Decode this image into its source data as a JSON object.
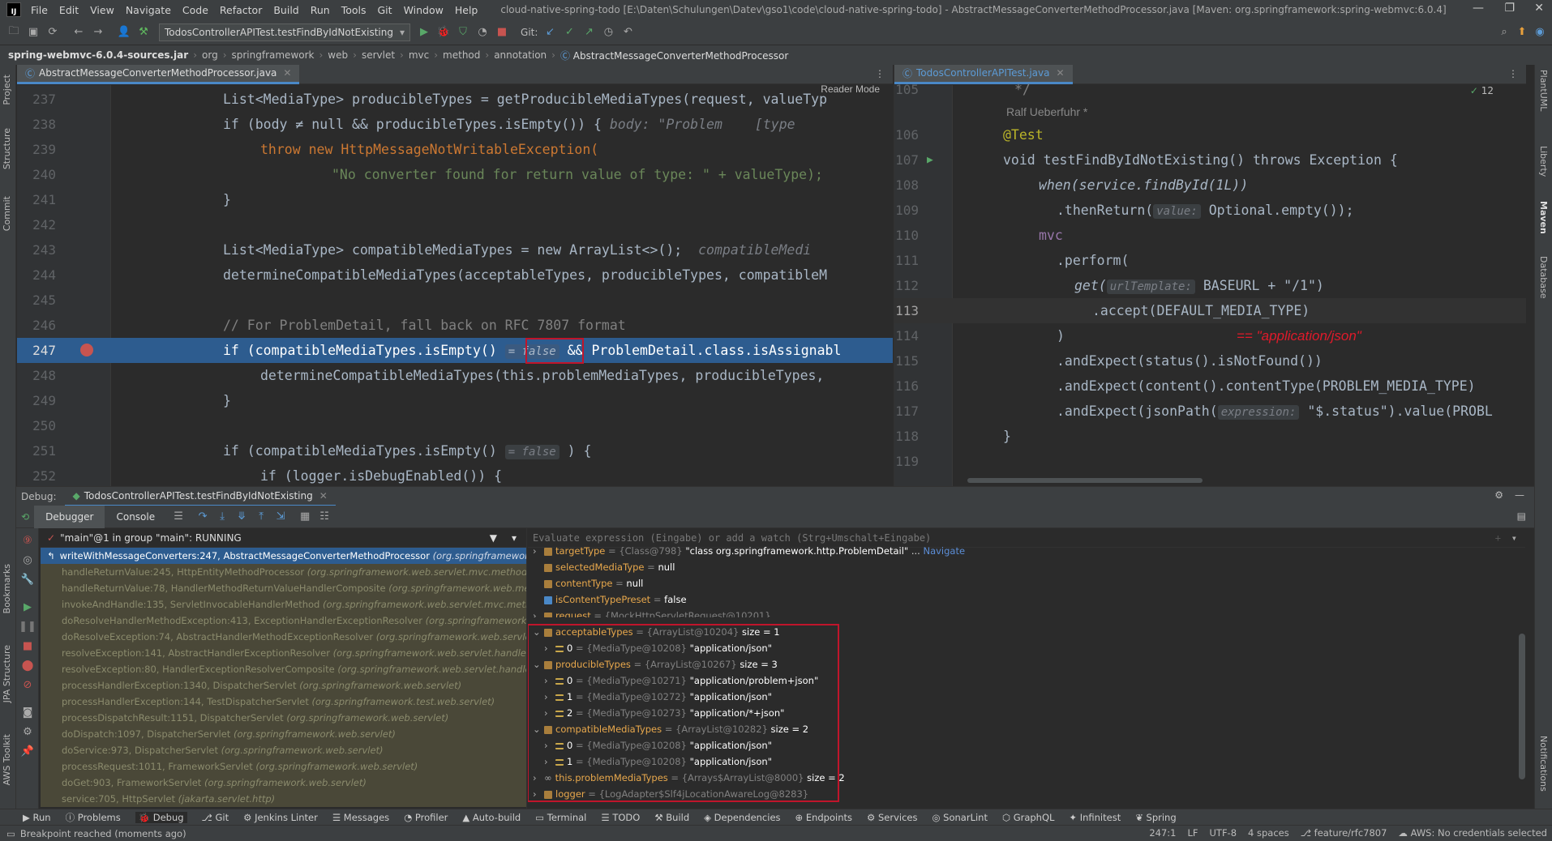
{
  "app": {
    "logo": "IJ",
    "window_title": "cloud-native-spring-todo [E:\\Daten\\Schulungen\\Datev\\gso1\\code\\cloud-native-spring-todo] - AbstractMessageConverterMethodProcessor.java [Maven: org.springframework:spring-webmvc:6.0.4]"
  },
  "menu": [
    "File",
    "Edit",
    "View",
    "Navigate",
    "Code",
    "Refactor",
    "Build",
    "Run",
    "Tools",
    "Git",
    "Window",
    "Help"
  ],
  "toolbar": {
    "run_config": "TodosControllerAPITest.testFindByIdNotExisting",
    "git_label": "Git:"
  },
  "breadcrumb": [
    "spring-webmvc-6.0.4-sources.jar",
    "org",
    "springframework",
    "web",
    "servlet",
    "mvc",
    "method",
    "annotation",
    "AbstractMessageConverterMethodProcessor"
  ],
  "left_strip": [
    "Project",
    "Structure",
    "Commit",
    "Bookmarks",
    "JPA Structure",
    "AWS Toolkit"
  ],
  "right_strip": [
    "PlantUML",
    "Liberty",
    "Maven",
    "Database",
    "Notifications"
  ],
  "editor_left": {
    "tab": "AbstractMessageConverterMethodProcessor.java",
    "reader_mode": "Reader Mode",
    "lines": [
      {
        "n": "237",
        "text": "List<MediaType> producibleTypes = getProducibleMediaTypes(request, valueTyp"
      },
      {
        "n": "238",
        "pre": "if (body ≠ null && producibleTypes.isEmpty()) {",
        "hint": "body: \"Problem",
        "hint2": "[type"
      },
      {
        "n": "239",
        "text": "throw new HttpMessageNotWritableException("
      },
      {
        "n": "240",
        "text": "\"No converter found for return value of type: \" + valueType);"
      },
      {
        "n": "241",
        "text": "}"
      },
      {
        "n": "242",
        "text": ""
      },
      {
        "n": "243",
        "pre": "List<MediaType> compatibleMediaTypes = new ArrayList<>();",
        "hint": "compatibleMedi"
      },
      {
        "n": "244",
        "text": "determineCompatibleMediaTypes(acceptableTypes, producibleTypes, compatibleM"
      },
      {
        "n": "245",
        "text": ""
      },
      {
        "n": "246",
        "text": "// For ProblemDetail, fall back on RFC 7807 format"
      },
      {
        "n": "247",
        "pre": "if (compatibleMediaTypes.isEmpty()",
        "hint": "= false",
        "post": "&& ProblemDetail.class.isAssignabl"
      },
      {
        "n": "248",
        "text": "determineCompatibleMediaTypes(this.problemMediaTypes, producibleTypes,"
      },
      {
        "n": "249",
        "text": "}"
      },
      {
        "n": "250",
        "text": ""
      },
      {
        "n": "251",
        "pre": "if (compatibleMediaTypes.isEmpty()",
        "hint": "= false",
        "post": ") {"
      },
      {
        "n": "252",
        "text": "if (logger.isDebugEnabled()) {"
      }
    ]
  },
  "editor_right": {
    "tab": "TodosControllerAPITest.java",
    "problems_count": "12",
    "author": "Ralf Ueberfuhr *",
    "lines": [
      {
        "n": "105",
        "text": "*/"
      },
      {
        "n": "106",
        "text": "@Test"
      },
      {
        "n": "107",
        "text": "void testFindByIdNotExisting() throws Exception {"
      },
      {
        "n": "108",
        "text": "when(service.findById(1L))"
      },
      {
        "n": "109",
        "pre": ".thenReturn(",
        "hint": "value:",
        "post": "Optional.empty());"
      },
      {
        "n": "110",
        "text": "mvc"
      },
      {
        "n": "111",
        "text": ".perform("
      },
      {
        "n": "112",
        "pre": "get(",
        "hint": "urlTemplate:",
        "post": "BASEURL + \"/1\")"
      },
      {
        "n": "113",
        "text": ".accept(DEFAULT_MEDIA_TYPE)"
      },
      {
        "n": "114",
        "text": ")",
        "annotation": "== \"application/json\""
      },
      {
        "n": "115",
        "text": ".andExpect(status().isNotFound())"
      },
      {
        "n": "116",
        "text": ".andExpect(content().contentType(PROBLEM_MEDIA_TYPE)"
      },
      {
        "n": "117",
        "pre": ".andExpect(jsonPath(",
        "hint": "expression:",
        "post": "\"$.status\").value(PROBL"
      },
      {
        "n": "118",
        "text": "}"
      },
      {
        "n": "119",
        "text": ""
      }
    ]
  },
  "debug": {
    "label": "Debug:",
    "session_tab": "TodosControllerAPITest.testFindByIdNotExisting",
    "tabs": [
      "Debugger",
      "Console"
    ],
    "thread": "\"main\"@1 in group \"main\": RUNNING",
    "eval_placeholder": "Evaluate expression (Eingabe) or add a watch (Strg+Umschalt+Eingabe)",
    "frames": [
      {
        "m": "writeWithMessageConverters:247, AbstractMessageConverterMethodProcessor",
        "p": "(org.springframework.web.ser"
      },
      {
        "m": "handleReturnValue:245, HttpEntityMethodProcessor",
        "p": "(org.springframework.web.servlet.mvc.method.annota"
      },
      {
        "m": "handleReturnValue:78, HandlerMethodReturnValueHandlerComposite",
        "p": "(org.springframework.web.method.sup"
      },
      {
        "m": "invokeAndHandle:135, ServletInvocableHandlerMethod",
        "p": "(org.springframework.web.servlet.mvc.method.annot"
      },
      {
        "m": "doResolveHandlerMethodException:413, ExceptionHandlerExceptionResolver",
        "p": "(org.springframework.web.serv"
      },
      {
        "m": "doResolveException:74, AbstractHandlerMethodExceptionResolver",
        "p": "(org.springframework.web.servlet.handle"
      },
      {
        "m": "resolveException:141, AbstractHandlerExceptionResolver",
        "p": "(org.springframework.web.servlet.handler)"
      },
      {
        "m": "resolveException:80, HandlerExceptionResolverComposite",
        "p": "(org.springframework.web.servlet.handler)"
      },
      {
        "m": "processHandlerException:1340, DispatcherServlet",
        "p": "(org.springframework.web.servlet)"
      },
      {
        "m": "processHandlerException:144, TestDispatcherServlet",
        "p": "(org.springframework.test.web.servlet)"
      },
      {
        "m": "processDispatchResult:1151, DispatcherServlet",
        "p": "(org.springframework.web.servlet)"
      },
      {
        "m": "doDispatch:1097, DispatcherServlet",
        "p": "(org.springframework.web.servlet)"
      },
      {
        "m": "doService:973, DispatcherServlet",
        "p": "(org.springframework.web.servlet)"
      },
      {
        "m": "processRequest:1011, FrameworkServlet",
        "p": "(org.springframework.web.servlet)"
      },
      {
        "m": "doGet:903, FrameworkServlet",
        "p": "(org.springframework.web.servlet)"
      },
      {
        "m": "service:705, HttpServlet",
        "p": "(jakarta.servlet.http)"
      }
    ],
    "variables": [
      {
        "indent": 0,
        "tog": "›",
        "icon": "f",
        "name": "targetType",
        "type": "= {Class@798}",
        "value": "\"class org.springframework.http.ProblemDetail\"",
        "nav": "Navigate"
      },
      {
        "indent": 0,
        "tog": "",
        "icon": "f",
        "name": "selectedMediaType",
        "type": "=",
        "value": "null"
      },
      {
        "indent": 0,
        "tog": "",
        "icon": "f",
        "name": "contentType",
        "type": "=",
        "value": "null"
      },
      {
        "indent": 0,
        "tog": "",
        "icon": "f",
        "name": "isContentTypePreset",
        "type": "=",
        "value": "false"
      },
      {
        "indent": 0,
        "tog": "›",
        "icon": "f",
        "name": "request",
        "type": "= {MockHttpServletRequest@10201}",
        "value": ""
      },
      {
        "indent": 0,
        "tog": "⌄",
        "icon": "f",
        "name": "acceptableTypes",
        "type": "= {ArrayList@10204}",
        "value": "size = 1"
      },
      {
        "indent": 1,
        "tog": "›",
        "icon": "l",
        "name": "0",
        "type": "= {MediaType@10208}",
        "value": "\"application/json\""
      },
      {
        "indent": 0,
        "tog": "⌄",
        "icon": "f",
        "name": "producibleTypes",
        "type": "= {ArrayList@10267}",
        "value": "size = 3"
      },
      {
        "indent": 1,
        "tog": "›",
        "icon": "l",
        "name": "0",
        "type": "= {MediaType@10271}",
        "value": "\"application/problem+json\""
      },
      {
        "indent": 1,
        "tog": "›",
        "icon": "l",
        "name": "1",
        "type": "= {MediaType@10272}",
        "value": "\"application/json\""
      },
      {
        "indent": 1,
        "tog": "›",
        "icon": "l",
        "name": "2",
        "type": "= {MediaType@10273}",
        "value": "\"application/*+json\""
      },
      {
        "indent": 0,
        "tog": "⌄",
        "icon": "f",
        "name": "compatibleMediaTypes",
        "type": "= {ArrayList@10282}",
        "value": "size = 2"
      },
      {
        "indent": 1,
        "tog": "›",
        "icon": "l",
        "name": "0",
        "type": "= {MediaType@10208}",
        "value": "\"application/json\""
      },
      {
        "indent": 1,
        "tog": "›",
        "icon": "l",
        "name": "1",
        "type": "= {MediaType@10208}",
        "value": "\"application/json\""
      },
      {
        "indent": 0,
        "tog": "›",
        "icon": "o",
        "name": "this.problemMediaTypes",
        "type": "= {Arrays$ArrayList@8000}",
        "value": "size = 2"
      },
      {
        "indent": 0,
        "tog": "›",
        "icon": "f",
        "name": "logger",
        "type": "= {LogAdapter$Slf4jLocationAwareLog@8283}",
        "value": ""
      }
    ]
  },
  "bottom_tools": [
    "Run",
    "Problems",
    "Debug",
    "Git",
    "Jenkins Linter",
    "Messages",
    "Profiler",
    "Auto-build",
    "Terminal",
    "TODO",
    "Build",
    "Dependencies",
    "Endpoints",
    "Services",
    "SonarLint",
    "GraphQL",
    "Infinitest",
    "Spring"
  ],
  "status": {
    "message": "Breakpoint reached (moments ago)",
    "position": "247:1",
    "line_sep": "LF",
    "encoding": "UTF-8",
    "indent": "4 spaces",
    "branch": "feature/rfc7807",
    "aws": "AWS: No credentials selected"
  },
  "colors": {
    "accent": "#4a88c7",
    "exec_line": "#2d5c8f",
    "highlight_box": "#c0152b",
    "annotation": "#e01a2a"
  }
}
